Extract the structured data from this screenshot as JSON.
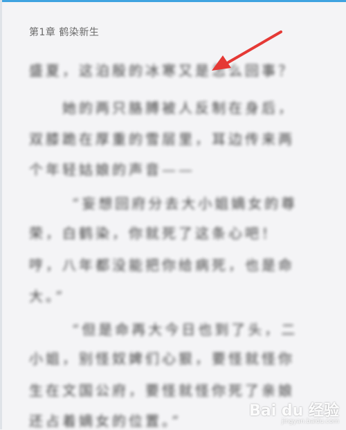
{
  "reader": {
    "chapter_title": "第1章 鹤染新生",
    "lines": [
      "盛夏，这泊殷的冰寒又是怎么回事？",
      "她的两只胳膊被人反制在身后，",
      "双膝跪在厚重的雪层里，耳边传来两",
      "个年轻姑娘的声音——",
      "“妄想回府分去大小姐嫡女的尊",
      "荣，白鹤染，你就死了这条心吧！",
      "哼，八年都没能把你给病死，也是命",
      "大。”",
      "“但是命再大今日也到了头，二",
      "小姐，别怪奴婢们心狠，要怪就怪你",
      "生在文国公府，要怪就怪你死了亲娘",
      "还占着嫡女的位置。”"
    ]
  },
  "watermark": {
    "brand": "Bai du 经验",
    "sub": "jingyan.baidu.com"
  },
  "colors": {
    "accent": "#3fa3e0",
    "arrow": "#e53935",
    "background": "#f4f4f6"
  }
}
